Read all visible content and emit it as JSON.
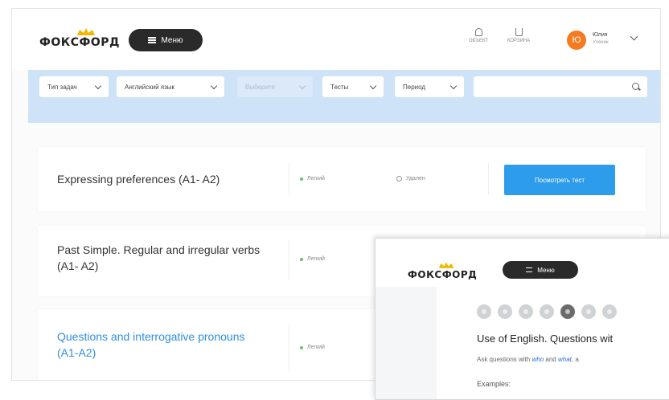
{
  "header": {
    "logo_text": "ФОКСФОРД",
    "menu_label": "Меню",
    "icons": [
      {
        "name": "bell-icon",
        "label": "ОБЪЕКТ"
      },
      {
        "name": "cart-icon",
        "label": "КОРЗИНА"
      }
    ],
    "user": {
      "avatar_letter": "Ю",
      "name": "Юлия",
      "subtitle": "Ученик"
    }
  },
  "filters": [
    {
      "label": "Тип задач",
      "disabled": false
    },
    {
      "label": "Английский язык",
      "disabled": false
    },
    {
      "label": "Выберите",
      "disabled": true
    },
    {
      "label": "Тесты",
      "disabled": false
    },
    {
      "label": "Период",
      "disabled": false
    }
  ],
  "search": {
    "placeholder": ""
  },
  "tests": [
    {
      "title": "Expressing preferences (A1- A2)",
      "level": "Легкий",
      "status": "Удален",
      "action": "Посмотреть тест",
      "is_link": false
    },
    {
      "title": "Past Simple. Regular and irregular verbs (A1- A2)",
      "level": "Легкий",
      "is_link": false
    },
    {
      "title": "Questions and interrogative pronouns (A1-A2)",
      "level": "Легкий",
      "is_link": true
    }
  ],
  "overlay": {
    "logo_text": "ФОКСФОРД",
    "menu_label": "Меню",
    "step_count": 7,
    "active_step": 5,
    "title": "Use of English. Questions wit",
    "subtitle_pre": "Ask questions with ",
    "subtitle_who": "who",
    "subtitle_mid": " and ",
    "subtitle_what": "what",
    "subtitle_post": ", a",
    "examples_label": "Examples:"
  },
  "colors": {
    "accent": "#2d9ceb",
    "filter_bar": "#cfe3f8",
    "avatar": "#f47b20",
    "link": "#2d8ee0",
    "level_dot": "#6abf69"
  }
}
